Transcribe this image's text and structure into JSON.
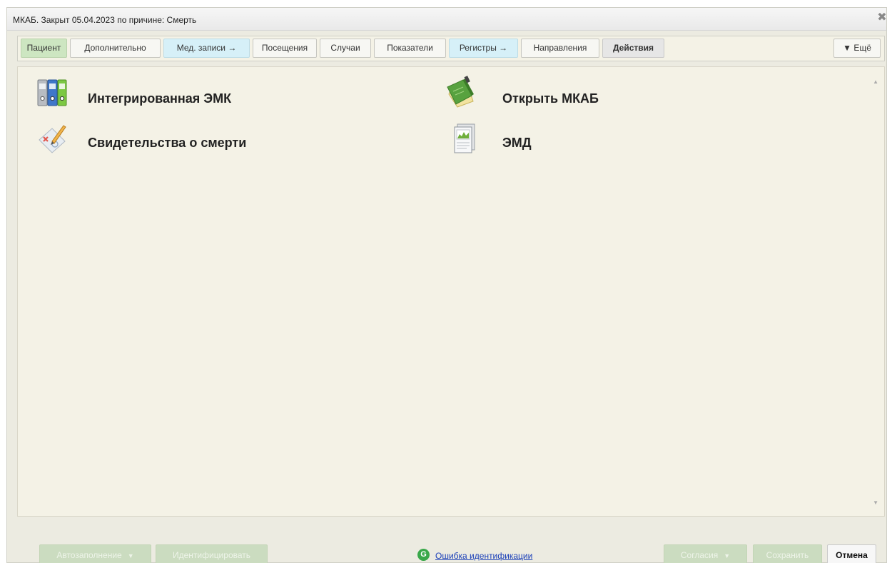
{
  "window": {
    "title": "МКАБ. Закрыт 05.04.2023 по причине: Смерть",
    "close_icon": "close-icon"
  },
  "tabs": [
    {
      "label": "Пациент",
      "style": "green"
    },
    {
      "label": "Дополнительно",
      "style": "plain"
    },
    {
      "label": "Мед. записи →",
      "style": "blue"
    },
    {
      "label": "Посещения",
      "style": "plain"
    },
    {
      "label": "Случаи",
      "style": "plain"
    },
    {
      "label": "Показатели",
      "style": "plain"
    },
    {
      "label": "Регистры →",
      "style": "blue"
    },
    {
      "label": "Направления",
      "style": "plain"
    },
    {
      "label": "Действия",
      "style": "gray",
      "active": true
    }
  ],
  "more_tab": {
    "label": "▼ Ещё"
  },
  "actions": [
    {
      "label": "Интегрированная ЭМК",
      "icon": "binders-icon"
    },
    {
      "label": "Открыть МКАБ",
      "icon": "green-book-icon"
    },
    {
      "label": "Свидетельства о смерти",
      "icon": "certificate-pencil-icon"
    },
    {
      "label": "ЭМД",
      "icon": "document-chart-icon"
    }
  ],
  "footer": {
    "autofill_label": "Автозаполнение",
    "identify_label": "Идентифицировать",
    "ident_error_link": "Ошибка идентификации",
    "consents_label": "Согласия",
    "save_label": "Сохранить",
    "cancel_label": "Отмена"
  },
  "colors": {
    "tab_green": "#cde6c1",
    "tab_blue": "#d6f0f8",
    "panel_bg": "#f4f2e6",
    "disabled_button": "#cbdcc0",
    "link": "#1a3fb8"
  }
}
